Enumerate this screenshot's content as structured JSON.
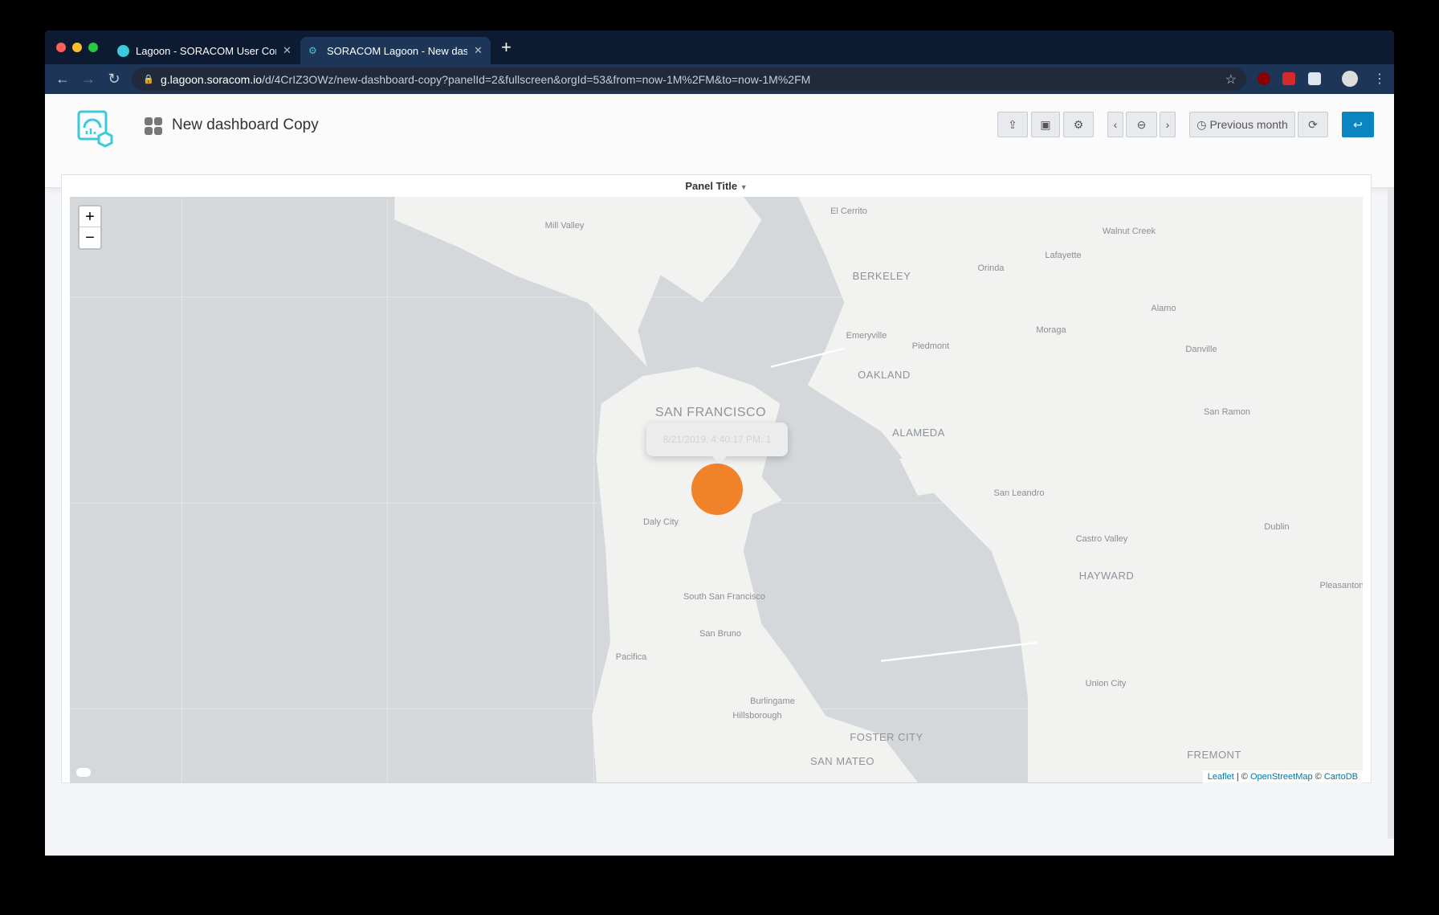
{
  "browser": {
    "tabs": [
      {
        "title": "Lagoon - SORACOM User Console",
        "active": false
      },
      {
        "title": "SORACOM Lagoon - New dashboard Copy",
        "active": true
      }
    ],
    "url_host": "g.lagoon.soracom.io",
    "url_path": "/d/4CrIZ3OWz/new-dashboard-copy?panelId=2&fullscreen&orgId=53&from=now-1M%2FM&to=now-1M%2FM"
  },
  "header": {
    "title": "New dashboard Copy",
    "time_range": "Previous month",
    "accent": "#0a85c2"
  },
  "panel": {
    "title": "Panel Title",
    "tooltip": "8/21/2019, 4:40:17 PM: 1",
    "marker_color": "#f0832a",
    "zoom_in": "+",
    "zoom_out": "−",
    "attribution": {
      "leaflet": "Leaflet",
      "sep": " | © ",
      "osm": "OpenStreetMap",
      "sep2": " © ",
      "carto": "CartoDB"
    },
    "labels": [
      "Mill Valley",
      "El Cerrito",
      "Walnut Creek",
      "Lafayette",
      "Orinda",
      "BERKELEY",
      "Alamo",
      "Moraga",
      "Emeryville",
      "Piedmont",
      "Danville",
      "OAKLAND",
      "SAN FRANCISCO",
      "San Ramon",
      "ALAMEDA",
      "San Leandro",
      "Daly City",
      "Dublin",
      "Castro Valley",
      "HAYWARD",
      "Pleasanton",
      "South San Francisco",
      "San Bruno",
      "Pacifica",
      "Union City",
      "Burlingame",
      "Hillsborough",
      "FOSTER CITY",
      "FREMONT",
      "SAN MATEO"
    ]
  }
}
